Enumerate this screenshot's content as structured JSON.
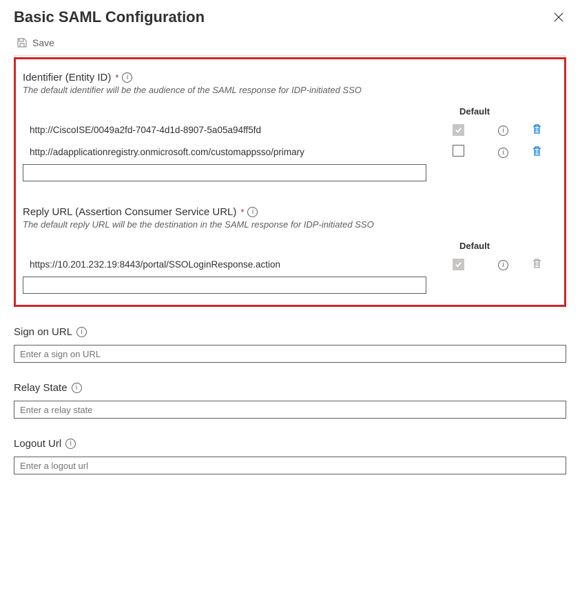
{
  "title": "Basic SAML Configuration",
  "toolbar": {
    "save_label": "Save"
  },
  "identifier": {
    "label": "Identifier (Entity ID)",
    "required": true,
    "desc": "The default identifier will be the audience of the SAML response for IDP-initiated SSO",
    "default_header": "Default",
    "rows": [
      {
        "url": "http://CiscoISE/0049a2fd-7047-4d1d-8907-5a05a94ff5fd",
        "default": true
      },
      {
        "url": "http://adapplicationregistry.onmicrosoft.com/customappsso/primary",
        "default": false
      }
    ]
  },
  "replyurl": {
    "label": "Reply URL (Assertion Consumer Service URL)",
    "required": true,
    "desc": "The default reply URL will be the destination in the SAML response for IDP-initiated SSO",
    "default_header": "Default",
    "rows": [
      {
        "url": "https://10.201.232.19:8443/portal/SSOLoginResponse.action",
        "default": true
      }
    ]
  },
  "signon": {
    "label": "Sign on URL",
    "placeholder": "Enter a sign on URL"
  },
  "relay": {
    "label": "Relay State",
    "placeholder": "Enter a relay state"
  },
  "logout": {
    "label": "Logout Url",
    "placeholder": "Enter a logout url"
  }
}
